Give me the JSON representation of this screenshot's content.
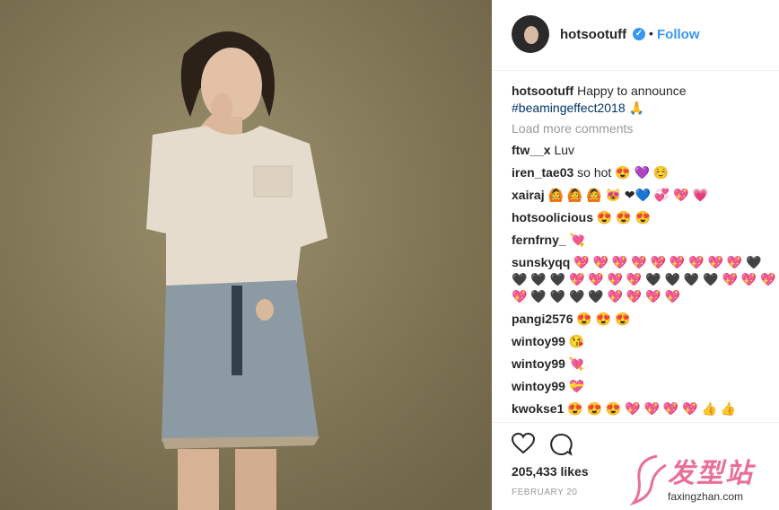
{
  "header": {
    "username": "hotsootuff",
    "separator": "•",
    "follow_label": "Follow",
    "verified_glyph": "✓"
  },
  "caption": {
    "username": "hotsootuff",
    "text": "Happy to announce",
    "hashtag": "#beamingeffect2018",
    "emoji": "🙏"
  },
  "load_more_label": "Load more comments",
  "comments": [
    {
      "user": "ftw__x",
      "text": "Luv"
    },
    {
      "user": "iren_tae03",
      "text": "so hot 😍 💜 ☺️"
    },
    {
      "user": "xairaj",
      "text": "🙆 🙆 🙆 😻 ❤💙 💞 💖 💗"
    },
    {
      "user": "hotsoolicious",
      "text": "😍 😍 😍"
    },
    {
      "user": "fernfrny_",
      "text": "💘"
    },
    {
      "user": "sunskyqq",
      "text": "💖 💖 💖 💖 💖 💖 💖 💖 💖 🖤 🖤 🖤 🖤 💖 💖 💖 💖 🖤 🖤 🖤 🖤 💖 💖 💖 💖 🖤 🖤 🖤 🖤 💖 💖 💖 💖"
    },
    {
      "user": "pangi2576",
      "text": "😍 😍 😍"
    },
    {
      "user": "wintoy99",
      "text": "😘"
    },
    {
      "user": "wintoy99",
      "text": "💘"
    },
    {
      "user": "wintoy99",
      "text": "💝"
    },
    {
      "user": "kwokse1",
      "text": "😍 😍 😍 💖 💖 💖 💖 👍 👍"
    }
  ],
  "likes": "205,433 likes",
  "date": "FEBRUARY 20",
  "icons": {
    "like": "heart-icon",
    "comment": "comment-icon"
  },
  "watermark": {
    "brand": "发型站",
    "url": "faxingzhan.com"
  },
  "colors": {
    "accent": "#3897f0",
    "muted": "#999999",
    "photo_bg": "#7d7354",
    "watermark": "#e86f9a"
  }
}
